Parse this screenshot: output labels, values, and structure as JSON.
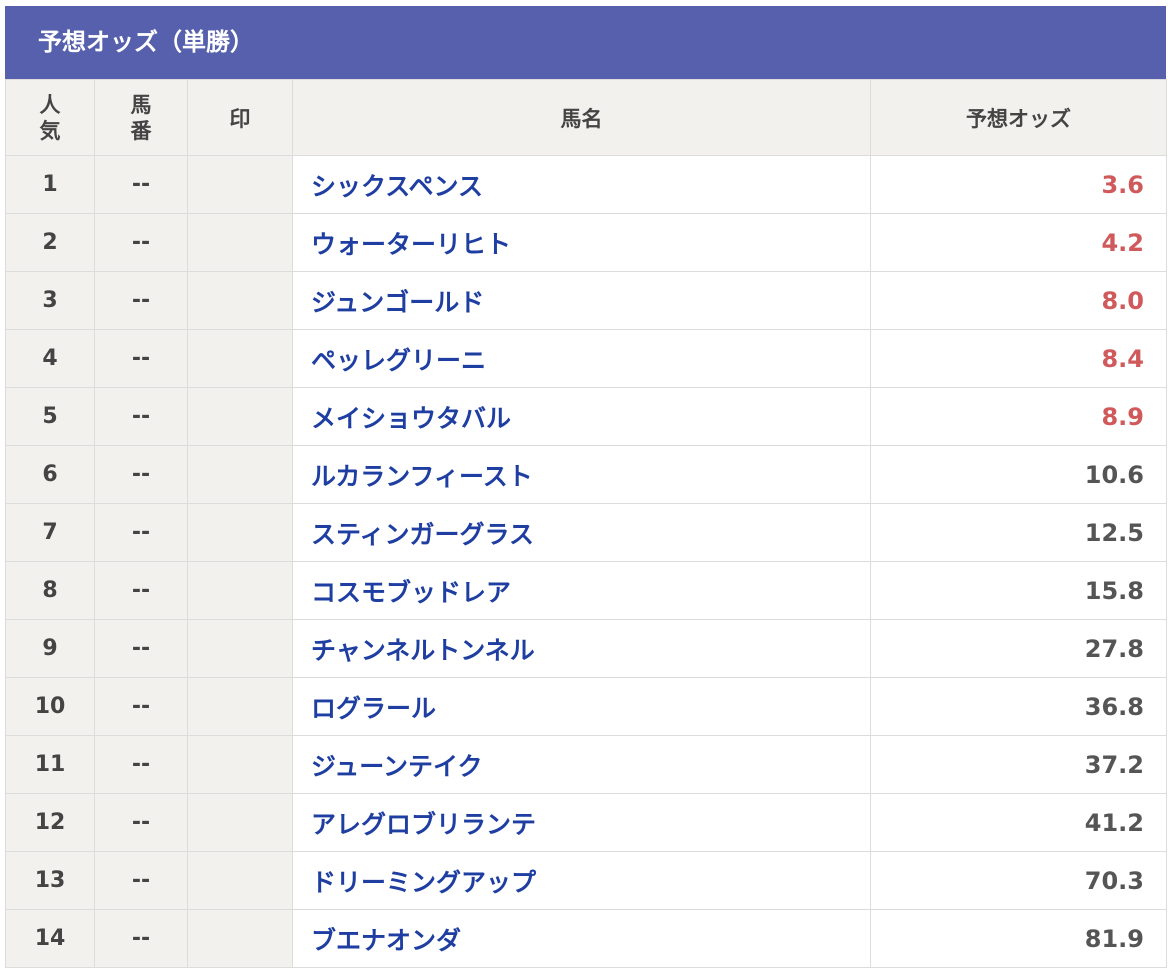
{
  "title": "予想オッズ（単勝）",
  "headers": {
    "rank": "人気",
    "number": "馬番",
    "mark": "印",
    "name": "馬名",
    "odds": "予想オッズ"
  },
  "colors": {
    "title_bar": "#5660ad",
    "horse_link": "#1f3ea1",
    "hot_odds": "#d0595b",
    "normal_odds": "#555555",
    "header_bg": "#f2f1ed"
  },
  "rows": [
    {
      "rank": "1",
      "number": "--",
      "mark": "",
      "name": "シックスペンス",
      "odds": "3.6",
      "hot": true
    },
    {
      "rank": "2",
      "number": "--",
      "mark": "",
      "name": "ウォーターリヒト",
      "odds": "4.2",
      "hot": true
    },
    {
      "rank": "3",
      "number": "--",
      "mark": "",
      "name": "ジュンゴールド",
      "odds": "8.0",
      "hot": true
    },
    {
      "rank": "4",
      "number": "--",
      "mark": "",
      "name": "ペッレグリーニ",
      "odds": "8.4",
      "hot": true
    },
    {
      "rank": "5",
      "number": "--",
      "mark": "",
      "name": "メイショウタバル",
      "odds": "8.9",
      "hot": true
    },
    {
      "rank": "6",
      "number": "--",
      "mark": "",
      "name": "ルカランフィースト",
      "odds": "10.6",
      "hot": false
    },
    {
      "rank": "7",
      "number": "--",
      "mark": "",
      "name": "スティンガーグラス",
      "odds": "12.5",
      "hot": false
    },
    {
      "rank": "8",
      "number": "--",
      "mark": "",
      "name": "コスモブッドレア",
      "odds": "15.8",
      "hot": false
    },
    {
      "rank": "9",
      "number": "--",
      "mark": "",
      "name": "チャンネルトンネル",
      "odds": "27.8",
      "hot": false
    },
    {
      "rank": "10",
      "number": "--",
      "mark": "",
      "name": "ログラール",
      "odds": "36.8",
      "hot": false
    },
    {
      "rank": "11",
      "number": "--",
      "mark": "",
      "name": "ジューンテイク",
      "odds": "37.2",
      "hot": false
    },
    {
      "rank": "12",
      "number": "--",
      "mark": "",
      "name": "アレグロブリランテ",
      "odds": "41.2",
      "hot": false
    },
    {
      "rank": "13",
      "number": "--",
      "mark": "",
      "name": "ドリーミングアップ",
      "odds": "70.3",
      "hot": false
    },
    {
      "rank": "14",
      "number": "--",
      "mark": "",
      "name": "ブエナオンダ",
      "odds": "81.9",
      "hot": false
    }
  ]
}
